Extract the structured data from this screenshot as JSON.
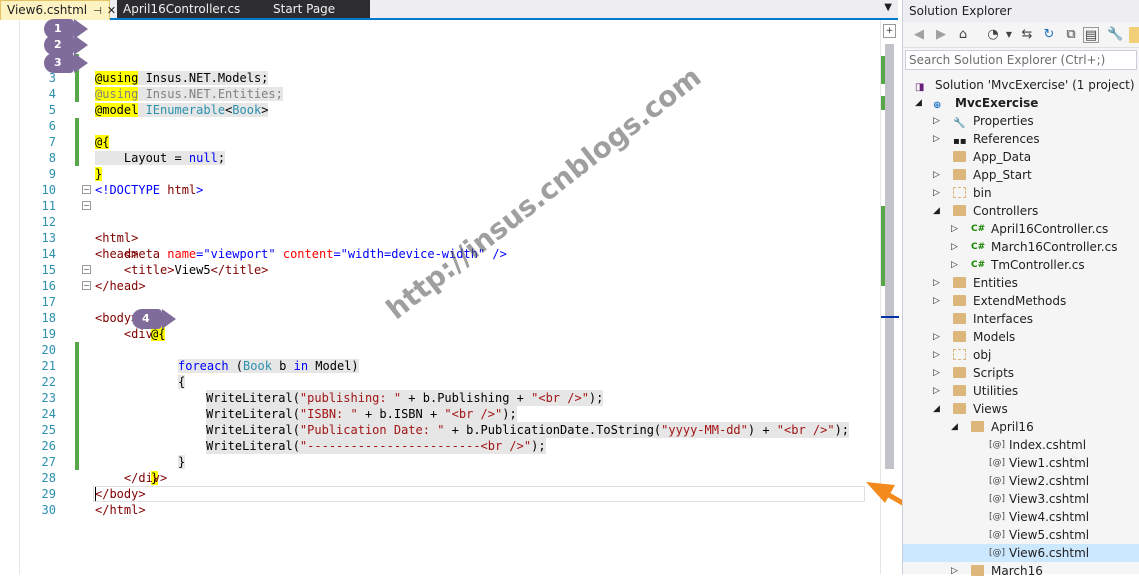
{
  "tabs": [
    {
      "label": "View6.cshtml",
      "active": true
    },
    {
      "label": "April16Controller.cs",
      "active": false
    },
    {
      "label": "Start Page",
      "active": false
    }
  ],
  "code_lines": [
    "1",
    "2",
    "3",
    "4",
    "5",
    "6",
    "7",
    "8",
    "9",
    "10",
    "11",
    "12",
    "13",
    "14",
    "15",
    "16",
    "17",
    "18",
    "19",
    "20",
    "21",
    "22",
    "23",
    "24",
    "25",
    "26",
    "27",
    "28",
    "29",
    "30"
  ],
  "code": {
    "l1_a": "@using",
    "l1_b": " Insus.NET.Models;",
    "l2_a": "@using",
    "l2_b": " Insus.NET.Entities;",
    "l3_a": "@model",
    "l3_b": " IEnumerable",
    "l3_c": "<",
    "l3_d": "Book",
    "l3_e": ">",
    "l5": "@{",
    "l6_a": "    Layout = ",
    "l6_b": "null",
    "l6_c": ";",
    "l7": "}",
    "l9_a": "<!DOCTYPE ",
    "l9_b": "html",
    "l9_c": ">",
    "l11": "<html>",
    "l12": "<head>",
    "l13_a": "    <meta ",
    "l13_b": "name",
    "l13_c": "=\"viewport\" ",
    "l13_d": "content",
    "l13_e": "=\"width=device-width\" />",
    "l14_a": "    <title>",
    "l14_b": "View5",
    "l14_c": "</title>",
    "l15": "</head>",
    "l16": "<body>",
    "l17": "    <div>",
    "l18": "@{",
    "l19_a": "foreach",
    "l19_b": " (",
    "l19_c": "Book",
    "l19_d": " b ",
    "l19_e": "in",
    "l19_f": " Model)",
    "l20": "{",
    "l21_a": "WriteLiteral(",
    "l21_b": "\"publishing: \"",
    "l21_c": " + b.Publishing + ",
    "l21_d": "\"<br />\"",
    "l21_e": ");",
    "l22_a": "WriteLiteral(",
    "l22_b": "\"ISBN: \"",
    "l22_c": " + b.ISBN + ",
    "l22_d": "\"<br />\"",
    "l22_e": ");",
    "l23_a": "WriteLiteral(",
    "l23_b": "\"Publication Date: \"",
    "l23_c": " + b.PublicationDate.ToString(",
    "l23_d": "\"yyyy-MM-dd\"",
    "l23_e": ") + ",
    "l23_f": "\"<br />\"",
    "l23_g": ");",
    "l24_a": "WriteLiteral(",
    "l24_b": "\"------------------------<br />\"",
    "l24_c": ");",
    "l25": "}",
    "l26": "}",
    "l27": "    </div>",
    "l28": "</body>",
    "l29": "</html>"
  },
  "badges": [
    "1",
    "2",
    "3",
    "4"
  ],
  "watermark": "http://insus.cnblogs.com",
  "solution_explorer": {
    "title": "Solution Explorer",
    "search_placeholder": "Search Solution Explorer (Ctrl+;)",
    "items": [
      {
        "label": "Solution 'MvcExercise' (1 project)",
        "icon": "solution-icon"
      },
      {
        "label": "MvcExercise",
        "icon": "project-icon",
        "bold": true
      },
      {
        "label": "Properties",
        "icon": "wrench-icon"
      },
      {
        "label": "References",
        "icon": "references-icon"
      },
      {
        "label": "App_Data",
        "icon": "folder-icon"
      },
      {
        "label": "App_Start",
        "icon": "folder-icon"
      },
      {
        "label": "bin",
        "icon": "folder-icon"
      },
      {
        "label": "Controllers",
        "icon": "folder-open-icon"
      },
      {
        "label": "April16Controller.cs",
        "icon": "csharp-file-icon"
      },
      {
        "label": "March16Controller.cs",
        "icon": "csharp-file-icon"
      },
      {
        "label": "TmController.cs",
        "icon": "csharp-file-icon"
      },
      {
        "label": "Entities",
        "icon": "folder-icon"
      },
      {
        "label": "ExtendMethods",
        "icon": "folder-icon"
      },
      {
        "label": "Interfaces",
        "icon": "folder-icon"
      },
      {
        "label": "Models",
        "icon": "folder-icon"
      },
      {
        "label": "obj",
        "icon": "folder-icon"
      },
      {
        "label": "Scripts",
        "icon": "folder-icon"
      },
      {
        "label": "Utilities",
        "icon": "folder-icon"
      },
      {
        "label": "Views",
        "icon": "folder-open-icon"
      },
      {
        "label": "April16",
        "icon": "folder-open-icon"
      },
      {
        "label": "Index.cshtml",
        "icon": "cshtml-file-icon"
      },
      {
        "label": "View1.cshtml",
        "icon": "cshtml-file-icon"
      },
      {
        "label": "View2.cshtml",
        "icon": "cshtml-file-icon"
      },
      {
        "label": "View3.cshtml",
        "icon": "cshtml-file-icon"
      },
      {
        "label": "View4.cshtml",
        "icon": "cshtml-file-icon"
      },
      {
        "label": "View5.cshtml",
        "icon": "cshtml-file-icon"
      },
      {
        "label": "View6.cshtml",
        "icon": "cshtml-file-icon",
        "selected": true
      },
      {
        "label": "March16",
        "icon": "folder-icon"
      }
    ]
  },
  "colors": {
    "accent": "#007acc",
    "annotation_arrow": "#f28a1e",
    "badge": "#7f6c9a",
    "highlight": "#ffff00"
  }
}
